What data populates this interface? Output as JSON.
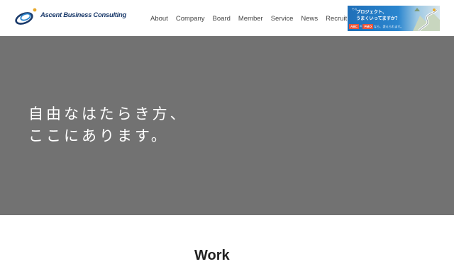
{
  "header": {
    "logo_text": "Ascent Business Consulting",
    "nav": [
      "About",
      "Company",
      "Board",
      "Member",
      "Service",
      "News",
      "Recruit"
    ]
  },
  "ad_banner": {
    "small_text": "その",
    "line1": "プロジェクト、",
    "line2": "うまくいってますか？",
    "chip1": "ABC",
    "connector": "の",
    "chip2": "PMO",
    "tail": "なら、変えられます。"
  },
  "hero": {
    "line1": "自由なはたらき方、",
    "line2": "ここにあります。"
  },
  "section": {
    "title": "Work"
  },
  "colors": {
    "hero_bg": "#727272",
    "brand_navy": "#1a3a6b",
    "banner_blue": "#2b86cf",
    "chip_red": "#e8543a"
  }
}
